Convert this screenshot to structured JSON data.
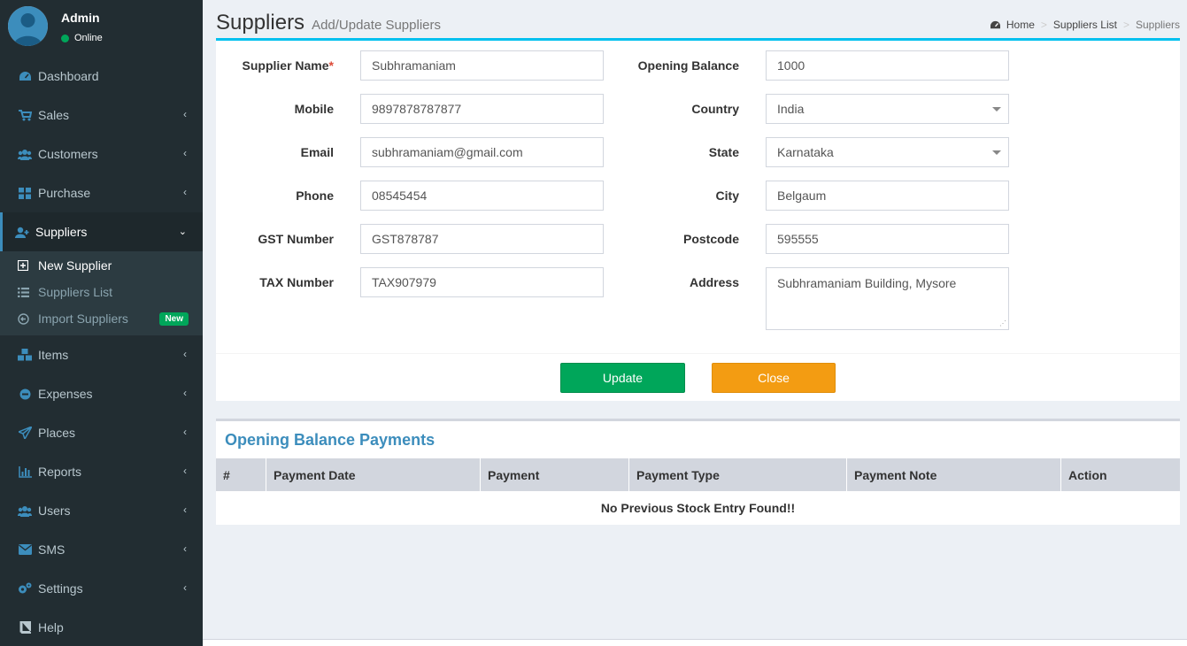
{
  "user": {
    "name": "Admin",
    "status": "Online"
  },
  "menu": [
    {
      "label": "Dashboard",
      "icon": "dashboard-icon"
    },
    {
      "label": "Sales",
      "icon": "cart-icon"
    },
    {
      "label": "Customers",
      "icon": "users-icon"
    },
    {
      "label": "Purchase",
      "icon": "grid-icon"
    },
    {
      "label": "Suppliers",
      "icon": "user-plus-icon"
    },
    {
      "label": "Items",
      "icon": "cubes-icon"
    },
    {
      "label": "Expenses",
      "icon": "minus-circle-icon"
    },
    {
      "label": "Places",
      "icon": "paper-plane-icon"
    },
    {
      "label": "Reports",
      "icon": "bar-chart-icon"
    },
    {
      "label": "Users",
      "icon": "users-icon"
    },
    {
      "label": "SMS",
      "icon": "envelope-icon"
    },
    {
      "label": "Settings",
      "icon": "cogs-icon"
    },
    {
      "label": "Help",
      "icon": "book-icon"
    }
  ],
  "submenu": [
    {
      "label": "New Supplier",
      "icon": "plus-square-icon"
    },
    {
      "label": "Suppliers List",
      "icon": "list-icon"
    },
    {
      "label": "Import Suppliers",
      "icon": "arrow-circle-icon",
      "badge": "New"
    }
  ],
  "header": {
    "title": "Suppliers",
    "subtitle": "Add/Update Suppliers"
  },
  "breadcrumb": {
    "home": "Home",
    "list": "Suppliers List",
    "current": "Suppliers"
  },
  "form": {
    "supplier_name": {
      "label": "Supplier Name",
      "required_mark": "*",
      "value": "Subhramaniam"
    },
    "mobile": {
      "label": "Mobile",
      "value": "9897878787877"
    },
    "email": {
      "label": "Email",
      "value": "subhramaniam@gmail.com"
    },
    "phone": {
      "label": "Phone",
      "value": "08545454"
    },
    "gst": {
      "label": "GST Number",
      "value": "GST878787"
    },
    "tax": {
      "label": "TAX Number",
      "value": "TAX907979"
    },
    "opening_balance": {
      "label": "Opening Balance",
      "value": "1000"
    },
    "country": {
      "label": "Country",
      "value": "India"
    },
    "state": {
      "label": "State",
      "value": "Karnataka"
    },
    "city": {
      "label": "City",
      "value": "Belgaum"
    },
    "postcode": {
      "label": "Postcode",
      "value": "595555"
    },
    "address": {
      "label": "Address",
      "value": "Subhramaniam Building, Mysore"
    }
  },
  "buttons": {
    "update": "Update",
    "close": "Close"
  },
  "payments": {
    "title": "Opening Balance Payments",
    "columns": [
      "#",
      "Payment Date",
      "Payment",
      "Payment Type",
      "Payment Note",
      "Action"
    ],
    "empty": "No Previous Stock Entry Found!!"
  },
  "colors": {
    "sidebar": "#222d32",
    "accent": "#3c8dbc",
    "success": "#00a65a",
    "warning": "#f39c12",
    "info": "#00c0ef"
  }
}
